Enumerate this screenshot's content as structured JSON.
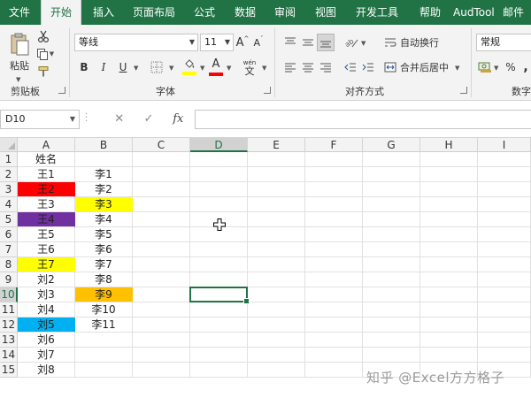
{
  "menu": {
    "tabs": [
      {
        "label": "文件",
        "active": false
      },
      {
        "label": "开始",
        "active": true
      },
      {
        "label": "插入",
        "active": false
      },
      {
        "label": "页面布局",
        "active": false
      },
      {
        "label": "公式",
        "active": false
      },
      {
        "label": "数据",
        "active": false
      },
      {
        "label": "审阅",
        "active": false
      },
      {
        "label": "视图",
        "active": false
      },
      {
        "label": "开发工具",
        "active": false
      },
      {
        "label": "帮助",
        "active": false
      },
      {
        "label": "AudTool",
        "active": false
      },
      {
        "label": "邮件",
        "active": false
      }
    ]
  },
  "ribbon": {
    "clipboard": {
      "paste_label": "粘贴",
      "group_label": "剪贴板"
    },
    "font": {
      "font_name": "等线",
      "font_size": "11",
      "bold": "B",
      "italic": "I",
      "underline": "U",
      "grow": "A",
      "shrink": "A",
      "font_color_letter": "A",
      "phonetic_label": "wén",
      "phonetic_char": "文",
      "group_label": "字体",
      "fill_color": "#ffff00",
      "font_color": "#ff0000"
    },
    "alignment": {
      "wrap_label": "自动换行",
      "merge_label": "合并后居中",
      "group_label": "对齐方式"
    },
    "number": {
      "format": "常规",
      "percent": "%",
      "comma": ",",
      "group_label": "数字"
    }
  },
  "formula_bar": {
    "name_box": "D10",
    "cancel": "✕",
    "enter": "✓",
    "fx": "fx",
    "formula": ""
  },
  "grid": {
    "columns": [
      "A",
      "B",
      "C",
      "D",
      "E",
      "F",
      "G",
      "H",
      "I"
    ],
    "selected_column": "D",
    "selected_row": 10,
    "active_cell": "D10",
    "rows": [
      {
        "n": 1,
        "a": "姓名",
        "a_fill": null,
        "b": "",
        "b_fill": null
      },
      {
        "n": 2,
        "a": "王1",
        "a_fill": null,
        "b": "李1",
        "b_fill": null
      },
      {
        "n": 3,
        "a": "王2",
        "a_fill": "#ff0000",
        "b": "李2",
        "b_fill": null
      },
      {
        "n": 4,
        "a": "王3",
        "a_fill": null,
        "b": "李3",
        "b_fill": "#ffff00"
      },
      {
        "n": 5,
        "a": "王4",
        "a_fill": "#7030a0",
        "b": "李4",
        "b_fill": null
      },
      {
        "n": 6,
        "a": "王5",
        "a_fill": null,
        "b": "李5",
        "b_fill": null
      },
      {
        "n": 7,
        "a": "王6",
        "a_fill": null,
        "b": "李6",
        "b_fill": null
      },
      {
        "n": 8,
        "a": "王7",
        "a_fill": "#ffff00",
        "b": "李7",
        "b_fill": null
      },
      {
        "n": 9,
        "a": "刘2",
        "a_fill": null,
        "b": "李8",
        "b_fill": null
      },
      {
        "n": 10,
        "a": "刘3",
        "a_fill": null,
        "b": "李9",
        "b_fill": "#ffc000"
      },
      {
        "n": 11,
        "a": "刘4",
        "a_fill": null,
        "b": "李10",
        "b_fill": null
      },
      {
        "n": 12,
        "a": "刘5",
        "a_fill": "#00b0f0",
        "b": "李11",
        "b_fill": null
      },
      {
        "n": 13,
        "a": "刘6",
        "a_fill": null,
        "b": "",
        "b_fill": null
      },
      {
        "n": 14,
        "a": "刘7",
        "a_fill": null,
        "b": "",
        "b_fill": null
      },
      {
        "n": 15,
        "a": "刘8",
        "a_fill": null,
        "b": "",
        "b_fill": null
      }
    ]
  },
  "watermark": "知乎 @Excel方方格子",
  "colors": {
    "brand": "#217346"
  }
}
